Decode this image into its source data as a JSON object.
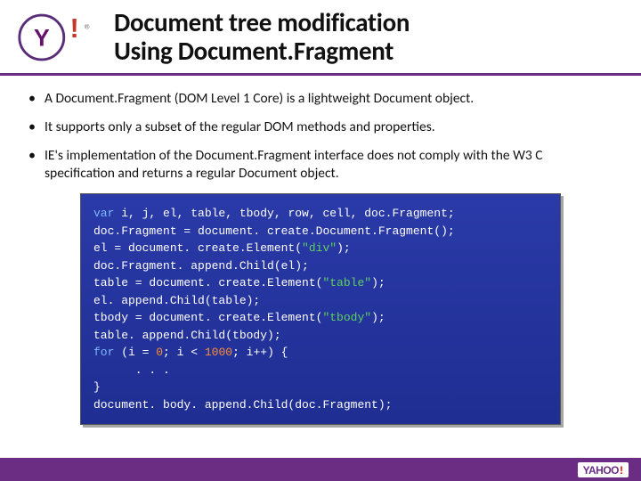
{
  "header": {
    "title_line1": "Document tree modification",
    "title_line2": "Using Document.Fragment"
  },
  "bullets": [
    "A Document.Fragment (DOM Level 1 Core) is a lightweight Document object.",
    "It supports only a subset of the regular DOM methods and properties.",
    "IE's implementation of the Document.Fragment interface does not comply with the W3 C specification and returns a regular Document object."
  ],
  "code": {
    "tokens": [
      [
        {
          "t": "var",
          "c": "kw"
        },
        {
          "t": " i, j, el, table, tbody, row, cell, doc.Fragment;",
          "c": ""
        }
      ],
      [
        {
          "t": "doc.Fragment = document. create.Document.Fragment();",
          "c": ""
        }
      ],
      [
        {
          "t": "el = document. create.Element(",
          "c": ""
        },
        {
          "t": "\"div\"",
          "c": "str"
        },
        {
          "t": ");",
          "c": ""
        }
      ],
      [
        {
          "t": "doc.Fragment. append.Child(el);",
          "c": ""
        }
      ],
      [
        {
          "t": "table = document. create.Element(",
          "c": ""
        },
        {
          "t": "\"table\"",
          "c": "str"
        },
        {
          "t": ");",
          "c": ""
        }
      ],
      [
        {
          "t": "el. append.Child(table);",
          "c": ""
        }
      ],
      [
        {
          "t": "tbody = document. create.Element(",
          "c": ""
        },
        {
          "t": "\"tbody\"",
          "c": "str"
        },
        {
          "t": ");",
          "c": ""
        }
      ],
      [
        {
          "t": "table. append.Child(tbody);",
          "c": ""
        }
      ],
      [
        {
          "t": "for",
          "c": "kw"
        },
        {
          "t": " (i = ",
          "c": ""
        },
        {
          "t": "0",
          "c": "num"
        },
        {
          "t": "; i < ",
          "c": ""
        },
        {
          "t": "1000",
          "c": "num"
        },
        {
          "t": "; i++) {",
          "c": ""
        }
      ],
      [
        {
          "t": "      . . .",
          "c": ""
        }
      ],
      [
        {
          "t": "}",
          "c": ""
        }
      ],
      [
        {
          "t": "document. body. append.Child(doc.Fragment);",
          "c": ""
        }
      ]
    ]
  },
  "footer": {
    "brand": "YAHOO!",
    "brand_short": "Y!"
  }
}
